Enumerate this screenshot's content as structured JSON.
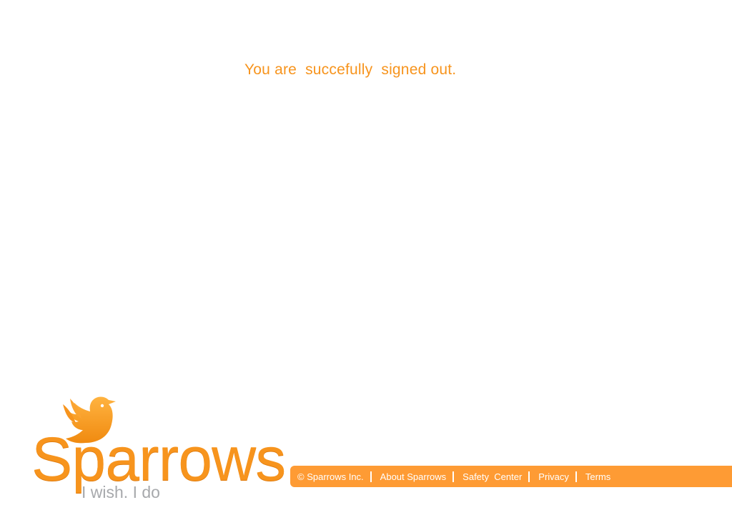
{
  "message": {
    "text": "You are  succefully  signed out."
  },
  "brand": {
    "name": "Sparrows",
    "tagline": "I wish. I do",
    "icon": "bird-icon",
    "color": "#f7941d"
  },
  "footer": {
    "background": "#fe9b34",
    "copyright": "© Sparrows Inc.",
    "links": [
      {
        "label": "About Sparrows"
      },
      {
        "label": "Safety  Center"
      },
      {
        "label": "Privacy"
      },
      {
        "label": "Terms"
      }
    ]
  }
}
